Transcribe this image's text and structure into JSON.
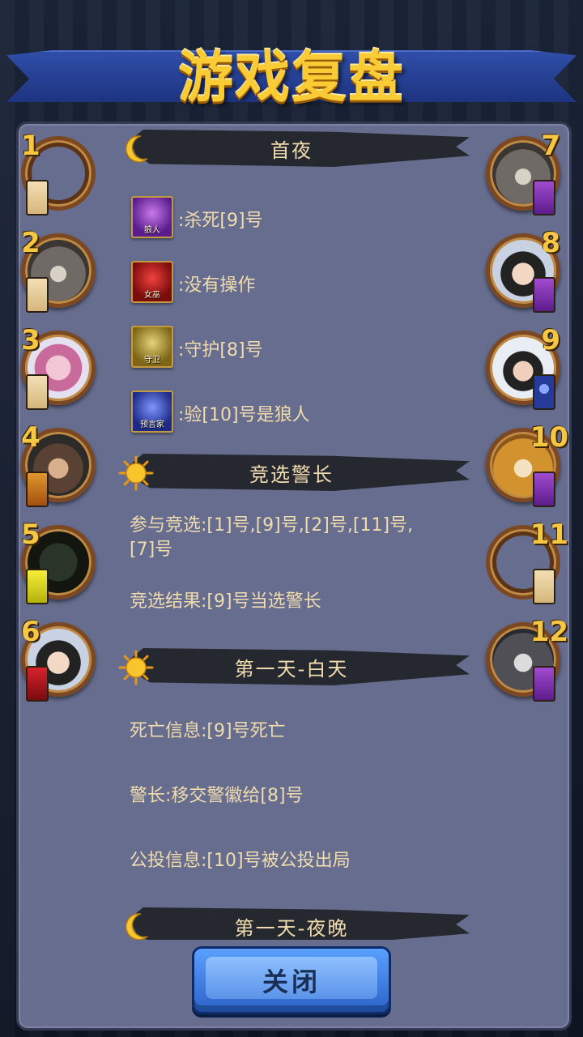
{
  "title": "游戏复盘",
  "players_left": [
    {
      "num": "1",
      "avatar": "empty-avatar",
      "role_badge": "villager"
    },
    {
      "num": "2",
      "avatar": "wolf-cartoon-avatar",
      "role_badge": "villager"
    },
    {
      "num": "3",
      "avatar": "anime-girl-avatar",
      "role_badge": "villager"
    },
    {
      "num": "4",
      "avatar": "child-photo-avatar",
      "role_badge": "hunter"
    },
    {
      "num": "5",
      "avatar": "dark-photo-avatar",
      "role_badge": "guard"
    },
    {
      "num": "6",
      "avatar": "woman-photo-avatar",
      "role_badge": "witch"
    }
  ],
  "players_right": [
    {
      "num": "7",
      "avatar": "wolf-cartoon-avatar",
      "role_badge": "werewolf"
    },
    {
      "num": "8",
      "avatar": "girl-photo-avatar",
      "role_badge": "werewolf"
    },
    {
      "num": "9",
      "avatar": "glasses-photo-avatar",
      "role_badge": "seer"
    },
    {
      "num": "10",
      "avatar": "dog-photo-avatar",
      "role_badge": "werewolf"
    },
    {
      "num": "11",
      "avatar": "empty-avatar",
      "role_badge": "villager"
    },
    {
      "num": "12",
      "avatar": "wolf-gray-avatar",
      "role_badge": "werewolf"
    }
  ],
  "sections": {
    "first_night": {
      "title": "首夜",
      "icon": "moon-icon",
      "entries": [
        {
          "role": "狼人",
          "text": ":杀死[9]号"
        },
        {
          "role": "女巫",
          "text": ":没有操作"
        },
        {
          "role": "守卫",
          "text": ":守护[8]号"
        },
        {
          "role": "预言家",
          "text": ":验[10]号是狼人"
        }
      ]
    },
    "election": {
      "title": "竞选警长",
      "icon": "sun-icon",
      "participants": "参与竞选:[1]号,[9]号,[2]号,[11]号,[7]号",
      "result": "竞选结果:[9]号当选警长"
    },
    "day1": {
      "title": "第一天-白天",
      "icon": "sun-icon",
      "death": "死亡信息:[9]号死亡",
      "badge": "警长:移交警徽给[8]号",
      "vote": "公投信息:[10]号被公投出局"
    },
    "night1": {
      "title": "第一天-夜晚",
      "icon": "moon-icon"
    }
  },
  "close_button": "关闭"
}
